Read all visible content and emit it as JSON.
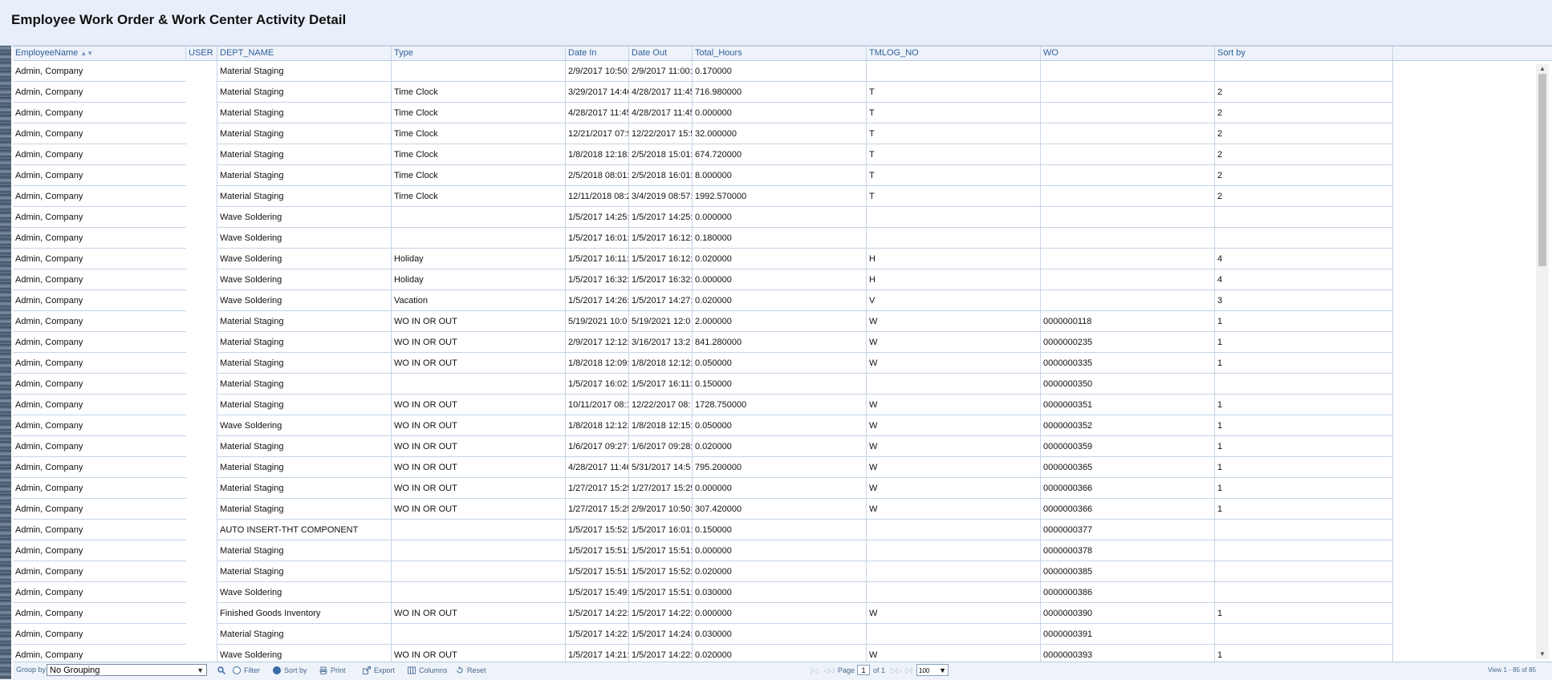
{
  "page": {
    "title": "Employee Work Order & Work Center Activity Detail"
  },
  "grid": {
    "columns": [
      "EmployeeName",
      "USER",
      "DEPT_NAME",
      "Type",
      "Date In",
      "Date Out",
      "Total_Hours",
      "TMLOG_NO",
      "WO",
      "Sort by"
    ],
    "sort_indicator": "▲▼",
    "rows": [
      [
        "Admin, Company",
        "",
        "Material Staging",
        "",
        "2/9/2017 10:50:",
        "2/9/2017 11:00:",
        "0.170000",
        "",
        "",
        ""
      ],
      [
        "Admin, Company",
        "",
        "Material Staging",
        "Time Clock",
        "3/29/2017 14:46",
        "4/28/2017 11:45",
        "716.980000",
        "T",
        "",
        "2"
      ],
      [
        "Admin, Company",
        "",
        "Material Staging",
        "Time Clock",
        "4/28/2017 11:45",
        "4/28/2017 11:45",
        "0.000000",
        "T",
        "",
        "2"
      ],
      [
        "Admin, Company",
        "",
        "Material Staging",
        "Time Clock",
        "12/21/2017 07:5",
        "12/22/2017 15:5",
        "32.000000",
        "T",
        "",
        "2"
      ],
      [
        "Admin, Company",
        "",
        "Material Staging",
        "Time Clock",
        "1/8/2018 12:18:",
        "2/5/2018 15:01:",
        "674.720000",
        "T",
        "",
        "2"
      ],
      [
        "Admin, Company",
        "",
        "Material Staging",
        "Time Clock",
        "2/5/2018 08:01:",
        "2/5/2018 16:01:",
        "8.000000",
        "T",
        "",
        "2"
      ],
      [
        "Admin, Company",
        "",
        "Material Staging",
        "Time Clock",
        "12/11/2018 08:2",
        "3/4/2019 08:57:",
        "1992.570000",
        "T",
        "",
        "2"
      ],
      [
        "Admin, Company",
        "",
        "Wave Soldering",
        "",
        "1/5/2017 14:25:",
        "1/5/2017 14:25:",
        "0.000000",
        "",
        "",
        ""
      ],
      [
        "Admin, Company",
        "",
        "Wave Soldering",
        "",
        "1/5/2017 16:01:",
        "1/5/2017 16:12:",
        "0.180000",
        "",
        "",
        ""
      ],
      [
        "Admin, Company",
        "",
        "Wave Soldering",
        "Holiday",
        "1/5/2017 16:11:",
        "1/5/2017 16:12:",
        "0.020000",
        "H",
        "",
        "4"
      ],
      [
        "Admin, Company",
        "",
        "Wave Soldering",
        "Holiday",
        "1/5/2017 16:32:",
        "1/5/2017 16:32:",
        "0.000000",
        "H",
        "",
        "4"
      ],
      [
        "Admin, Company",
        "",
        "Wave Soldering",
        "Vacation",
        "1/5/2017 14:26:",
        "1/5/2017 14:27:",
        "0.020000",
        "V",
        "",
        "3"
      ],
      [
        "Admin, Company",
        "",
        "Material Staging",
        "WO IN OR OUT",
        "5/19/2021 10:0",
        "5/19/2021 12:0",
        "2.000000",
        "W",
        "0000000118",
        "1"
      ],
      [
        "Admin, Company",
        "",
        "Material Staging",
        "WO IN OR OUT",
        "2/9/2017 12:12:",
        "3/16/2017 13:2",
        "841.280000",
        "W",
        "0000000235",
        "1"
      ],
      [
        "Admin, Company",
        "",
        "Material Staging",
        "WO IN OR OUT",
        "1/8/2018 12:09:",
        "1/8/2018 12:12:",
        "0.050000",
        "W",
        "0000000335",
        "1"
      ],
      [
        "Admin, Company",
        "",
        "Material Staging",
        "",
        "1/5/2017 16:02:",
        "1/5/2017 16:11:",
        "0.150000",
        "",
        "0000000350",
        ""
      ],
      [
        "Admin, Company",
        "",
        "Material Staging",
        "WO IN OR OUT",
        "10/11/2017 08:1",
        "12/22/2017 08:",
        "1728.750000",
        "W",
        "0000000351",
        "1"
      ],
      [
        "Admin, Company",
        "",
        "Wave Soldering",
        "WO IN OR OUT",
        "1/8/2018 12:12:",
        "1/8/2018 12:15:",
        "0.050000",
        "W",
        "0000000352",
        "1"
      ],
      [
        "Admin, Company",
        "",
        "Material Staging",
        "WO IN OR OUT",
        "1/6/2017 09:27:",
        "1/6/2017 09:28:",
        "0.020000",
        "W",
        "0000000359",
        "1"
      ],
      [
        "Admin, Company",
        "",
        "Material Staging",
        "WO IN OR OUT",
        "4/28/2017 11:46",
        "5/31/2017 14:5",
        "795.200000",
        "W",
        "0000000365",
        "1"
      ],
      [
        "Admin, Company",
        "",
        "Material Staging",
        "WO IN OR OUT",
        "1/27/2017 15:25",
        "1/27/2017 15:25",
        "0.000000",
        "W",
        "0000000366",
        "1"
      ],
      [
        "Admin, Company",
        "",
        "Material Staging",
        "WO IN OR OUT",
        "1/27/2017 15:25",
        "2/9/2017 10:50:",
        "307.420000",
        "W",
        "0000000366",
        "1"
      ],
      [
        "Admin, Company",
        "",
        "AUTO INSERT-THT COMPONENT",
        "",
        "1/5/2017 15:52:",
        "1/5/2017 16:01:",
        "0.150000",
        "",
        "0000000377",
        ""
      ],
      [
        "Admin, Company",
        "",
        "Material Staging",
        "",
        "1/5/2017 15:51:",
        "1/5/2017 15:51:",
        "0.000000",
        "",
        "0000000378",
        ""
      ],
      [
        "Admin, Company",
        "",
        "Material Staging",
        "",
        "1/5/2017 15:51:",
        "1/5/2017 15:52:",
        "0.020000",
        "",
        "0000000385",
        ""
      ],
      [
        "Admin, Company",
        "",
        "Wave Soldering",
        "",
        "1/5/2017 15:49:",
        "1/5/2017 15:51:",
        "0.030000",
        "",
        "0000000386",
        ""
      ],
      [
        "Admin, Company",
        "",
        "Finished Goods Inventory",
        "WO IN OR OUT",
        "1/5/2017 14:22:",
        "1/5/2017 14:22:",
        "0.000000",
        "W",
        "0000000390",
        "1"
      ],
      [
        "Admin, Company",
        "",
        "Material Staging",
        "",
        "1/5/2017 14:22:",
        "1/5/2017 14:24:",
        "0.030000",
        "",
        "0000000391",
        ""
      ],
      [
        "Admin, Company",
        "",
        "Wave Soldering",
        "WO IN OR OUT",
        "1/5/2017 14:21:",
        "1/5/2017 14:22:",
        "0.020000",
        "W",
        "0000000393",
        "1"
      ]
    ]
  },
  "footer": {
    "group_by_label": "Group by:",
    "group_by_value": "No Grouping",
    "toolbar": {
      "filter": "Filter",
      "sort_by": "Sort by",
      "print": "Print",
      "export": "Export",
      "columns": "Columns",
      "reset": "Reset"
    },
    "pager": {
      "nav_first": "|◁",
      "nav_prev": "◁◁",
      "page_label": "Page",
      "page_value": "1",
      "of_label": "of 1",
      "nav_next": "▷▷",
      "nav_last": "▷|",
      "rows_per_page": "100",
      "view_info": "View 1 - 85 of 85"
    }
  },
  "icons": {
    "search": "search-icon",
    "filter": "filter-icon",
    "sort": "sort-icon",
    "print": "print-icon",
    "export": "export-icon",
    "columns": "columns-icon",
    "reset": "reset-icon"
  },
  "colors": {
    "header_text": "#2f5f9a",
    "title_bar_bg": "#e8effa",
    "grid_lines": "#c4d4e6"
  }
}
